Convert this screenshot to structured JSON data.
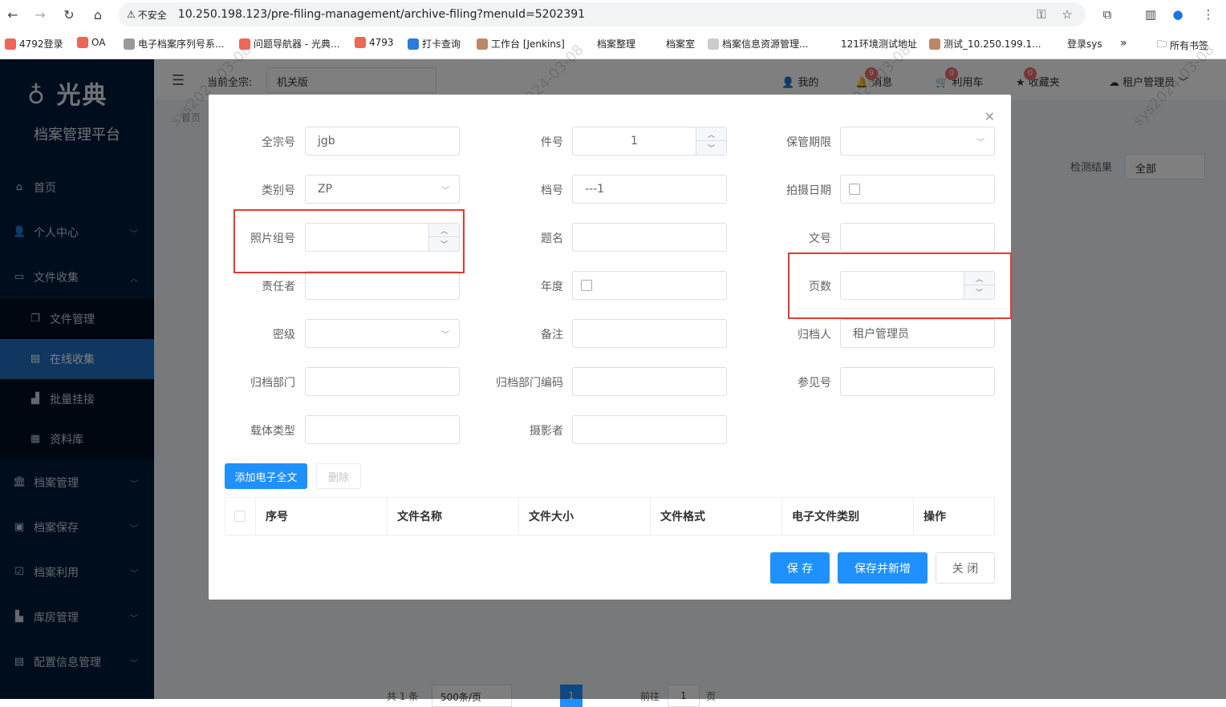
{
  "browser": {
    "security_label": "不安全",
    "url": "10.250.198.123/pre-filing-management/archive-filing?menuId=5202391",
    "bookmarks": [
      "4792登录",
      "OA",
      "电子档案序列号系...",
      "问题导航器 - 光典...",
      "4793",
      "打卡查询",
      "工作台 [Jenkins]",
      "档案整理",
      "档案室",
      "档案信息资源管理...",
      "121环境测试地址",
      "测试_10.250.199.1...",
      "登录sys",
      "»",
      "所有书签"
    ]
  },
  "sidebar": {
    "logo": "光典",
    "platform": "档案管理平台",
    "items": [
      {
        "label": "首页",
        "icon": "home-icon"
      },
      {
        "label": "个人中心",
        "icon": "user-icon"
      },
      {
        "label": "文件收集",
        "icon": "folder-icon"
      },
      {
        "label": "文件管理",
        "icon": "file-icon"
      },
      {
        "label": "在线收集",
        "icon": "document-icon"
      },
      {
        "label": "批量挂接",
        "icon": "chart-icon"
      },
      {
        "label": "资料库",
        "icon": "calendar-icon"
      },
      {
        "label": "档案管理",
        "icon": "bank-icon"
      },
      {
        "label": "档案保存",
        "icon": "save-icon"
      },
      {
        "label": "档案利用",
        "icon": "check-icon"
      },
      {
        "label": "库房管理",
        "icon": "warehouse-icon"
      },
      {
        "label": "配置信息管理",
        "icon": "clipboard-icon"
      }
    ]
  },
  "header": {
    "fonds_label": "当前全宗:",
    "fonds_value": "机关版",
    "mine": "我的",
    "messages": "消息",
    "messages_badge": "9",
    "cart": "利用车",
    "cart_badge": "0",
    "favorites": "收藏夹",
    "favorites_badge": "0",
    "user": "租户管理员"
  },
  "background": {
    "breadcrumb": "首页",
    "detect_label": "检测结果",
    "detect_value": "全部",
    "pagination_total": "共 1 条",
    "page_size": "500条/页",
    "page_current": "1",
    "goto_label": "前往",
    "goto_value": "1",
    "page_unit": "页",
    "watermark": "sys2024-03-08"
  },
  "form": {
    "fonds_no": {
      "label": "全宗号",
      "value": "jgb"
    },
    "item_no": {
      "label": "件号",
      "value": "1"
    },
    "retention": {
      "label": "保管期限",
      "value": ""
    },
    "category_no": {
      "label": "类别号",
      "value": "ZP"
    },
    "archive_no": {
      "label": "档号",
      "value": "---1"
    },
    "photo_date": {
      "label": "拍摄日期",
      "value": ""
    },
    "photo_group_no": {
      "label": "照片组号",
      "value": ""
    },
    "title": {
      "label": "题名",
      "value": ""
    },
    "doc_no": {
      "label": "文号",
      "value": ""
    },
    "responsible": {
      "label": "责任者",
      "value": ""
    },
    "year": {
      "label": "年度",
      "value": ""
    },
    "pages": {
      "label": "页数",
      "value": ""
    },
    "secret_level": {
      "label": "密级",
      "value": ""
    },
    "remark": {
      "label": "备注",
      "value": ""
    },
    "archiver": {
      "label": "归档人",
      "value": "租户管理员"
    },
    "archive_dept": {
      "label": "归档部门",
      "value": ""
    },
    "archive_dept_code": {
      "label": "归档部门编码",
      "value": ""
    },
    "ref_no": {
      "label": "参见号",
      "value": ""
    },
    "carrier_type": {
      "label": "载体类型",
      "value": ""
    },
    "photographer": {
      "label": "摄影者",
      "value": ""
    }
  },
  "actions": {
    "add_fulltext": "添加电子全文",
    "delete": "删除",
    "save": "保 存",
    "save_new": "保存并新增",
    "close": "关 闭"
  },
  "table": {
    "columns": [
      "序号",
      "文件名称",
      "文件大小",
      "文件格式",
      "电子文件类别",
      "操作"
    ]
  },
  "colors": {
    "primary": "#1e90ff",
    "sidebar": "#001a3a",
    "highlight": "#e53935"
  }
}
